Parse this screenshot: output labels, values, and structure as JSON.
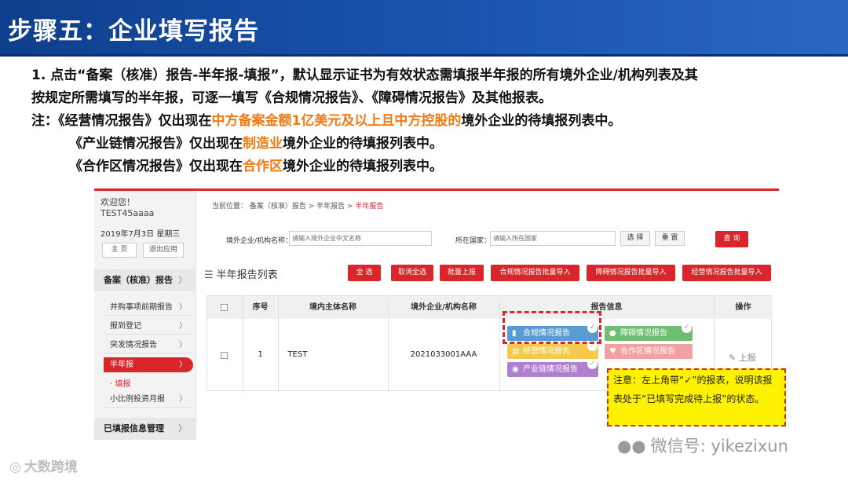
{
  "slide": {
    "title": "步骤五：企业填写报告",
    "intro": [
      {
        "text": "1. 点击“备案（核准）报告-半年报-填报”，默认显示证书为有效状态需填报半年报的所有境外企业/机构列表及其"
      },
      {
        "text": "按规定所需填写的半年报，可逐一填写《合规情况报告》、《障碍情况报告》及其他报表。"
      }
    ],
    "note1": {
      "prefix": "注：《经营情况报告》仅出现在",
      "highlight": "中方备案金额1亿美元及以上且中方控股的",
      "suffix": "境外企业的待填报列表中。"
    },
    "note2": {
      "prefix": "《产业链情况报告》仅出现在",
      "highlight": "制造业",
      "suffix": "境外企业的待填报列表中。"
    },
    "note3": {
      "prefix": "《合作区情况报告》仅出现在",
      "highlight": "合作区",
      "suffix": "境外企业的待填报列表中。"
    },
    "highlight_color": "#f07a13"
  },
  "app": {
    "accent": "#d8262b",
    "sidebar": {
      "welcome": "欢迎您！",
      "user": "TEST45aaaa",
      "date": "2019年7月3日 星期三",
      "home_btn": "主 页",
      "logout_btn": "退出应用",
      "group1": "备案（核准）报告",
      "items": [
        "并购事项前期报告",
        "报到登记",
        "突发情况报告",
        "半年报",
        "小比例投资月报"
      ],
      "sub_item": "· 填报",
      "group2": "已填报信息管理"
    },
    "breadcrumb": {
      "prefix": "当前位置： 备案（核准）报告 > 半年报告 > ",
      "current": "半年报告"
    },
    "filters": {
      "company_label": "境外企业/机构名称：",
      "company_placeholder": "请输入境外企业中文名称",
      "country_label": "所在国家：",
      "country_placeholder": "请输入所在国家",
      "select_btn": "选 择",
      "reset_btn": "重 置",
      "search_btn": "查 询"
    },
    "list_title": "半年报告列表",
    "actions": [
      "全 选",
      "取消全选",
      "批量上报",
      "合规情况报告批量导入",
      "障碍情况报告批量导入",
      "经营情况报告批量导入"
    ],
    "table": {
      "headers": [
        "序号",
        "境内主体名称",
        "境外企业/机构名称",
        "报告信息",
        "操作"
      ],
      "row": {
        "index": "1",
        "domestic": "TEST",
        "overseas": "2021033001AAA"
      },
      "reports": [
        {
          "label": "合规情况报告",
          "color": "#5b9bd5",
          "icon": "document-icon",
          "done": true
        },
        {
          "label": "障碍情况报告",
          "color": "#6fbf73",
          "icon": "info-icon",
          "done": true
        },
        {
          "label": "经营情况报告",
          "color": "#f5c94d",
          "icon": "chart-icon",
          "done": true
        },
        {
          "label": "合作区情况报告",
          "color": "#f5a0a0",
          "icon": "heart-icon",
          "done": false
        },
        {
          "label": "产业链情况报告",
          "color": "#b07fd0",
          "icon": "circle-icon",
          "done": true
        }
      ],
      "upload": "上报"
    }
  },
  "callout": {
    "text": "注意：左上角带“✓”的报表，说明该报表处于“已填写完成待上报”的状态。"
  },
  "watermark": {
    "wechat": "微信号: yikezixun",
    "brand": "大数跨境"
  }
}
